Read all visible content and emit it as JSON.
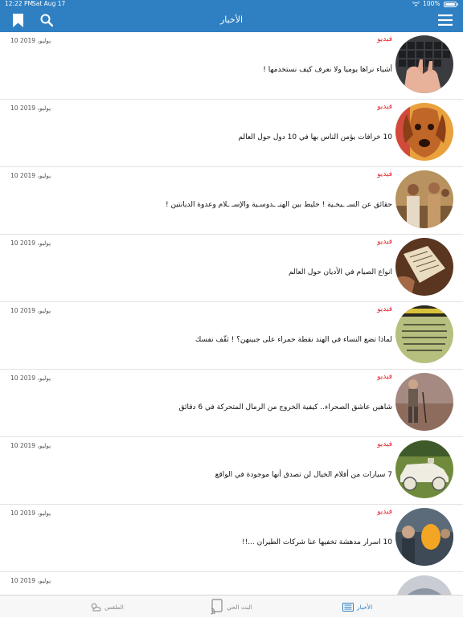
{
  "status": {
    "time": "12:22 PM",
    "date": "Sat Aug 17",
    "battery": "100%"
  },
  "nav": {
    "title": "الأخبار"
  },
  "articles": [
    {
      "category": "فيديو",
      "date": "10 يوليو، 2019",
      "headline": "أشياء نراها يوميا ولا نعرف كيف نستخدمها !"
    },
    {
      "category": "فيديو",
      "date": "10 يوليو، 2019",
      "headline": "10 خرافات يؤمن الناس بها في 10 دول حول العالم"
    },
    {
      "category": "فيديو",
      "date": "10 يوليو، 2019",
      "headline": "حقائق عن السـ ـيخـية ! خليط بين الهنـ ـدوسـية والإسـ ـلام وعدوة الديانتين !"
    },
    {
      "category": "فيديو",
      "date": "10 يوليو، 2019",
      "headline": "انواع الصيام في الأديان حول العالم"
    },
    {
      "category": "فيديو",
      "date": "10 يوليو، 2019",
      "headline": "لماذا تضع النساء في الهند نقطة حمراء على جبينهن؟ ! ثقّف نفسك"
    },
    {
      "category": "فيديو",
      "date": "10 يوليو، 2019",
      "headline": "شاهين عاشق الصحراء.. كيفية الخروج من الرمال المتحركة في 6 دقائق"
    },
    {
      "category": "فيديو",
      "date": "10 يوليو، 2019",
      "headline": "7 سيارات من أفلام الخيال لن تصدق أنها موجودة في الواقع"
    },
    {
      "category": "فيديو",
      "date": "10 يوليو، 2019",
      "headline": "10 اسرار مدهشة تخفيها عنا شركات الطيران ...!!"
    },
    {
      "category": "",
      "date": "10 يوليو، 2019",
      "headline": ""
    }
  ],
  "tabs": {
    "weather": "الطقس",
    "live": "البث الحي",
    "news": "الأخبار"
  },
  "colors": {
    "brand": "#2f80c3",
    "category": "#e0282e"
  }
}
